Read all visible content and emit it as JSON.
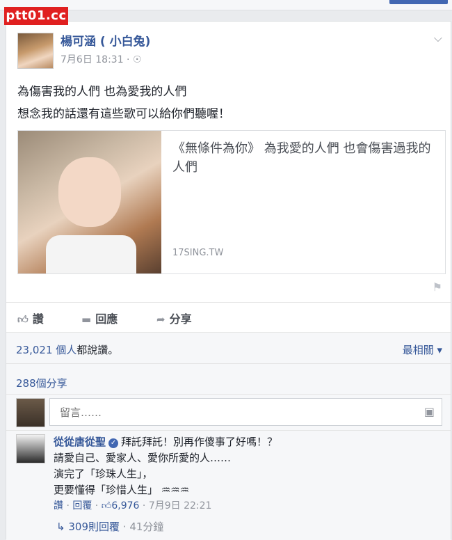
{
  "watermark": "ptt01.cc",
  "post": {
    "author": "楊可涵 ( 小白兔)",
    "time": "7月6日 18:31 · ",
    "globe_icon": "globe-icon",
    "text_lines": [
      "為傷害我的人們 也為愛我的人們",
      "想念我的話還有這些歌可以給你們聽喔！"
    ],
    "link_card": {
      "title": "《無條件為你》 為我愛的人們 也會傷害過我的人們",
      "domain": "17SING.TW"
    }
  },
  "actions": {
    "like": "讚",
    "comment": "回應",
    "share": "分享"
  },
  "engagement": {
    "likes_count": "23,021 個人",
    "likes_suffix": "都說讚。",
    "sort_label": "最相關 ▾",
    "shares": "288個分享"
  },
  "comment_box": {
    "placeholder": "留言……"
  },
  "comment": {
    "author": "從從唐從聖",
    "lines": [
      "拜託拜託！別再作傻事了好嗎！？",
      "請愛自己、愛家人、愛你所愛的人……",
      "演完了「珍珠人生」，",
      "更要懂得「珍惜人生」 ♒♒♒"
    ],
    "like_link": "讚",
    "reply_link": "回覆",
    "like_count": "6,976",
    "date": "7月9日 22:21",
    "replies_link": "309則回覆",
    "replies_time": "41分鐘"
  }
}
